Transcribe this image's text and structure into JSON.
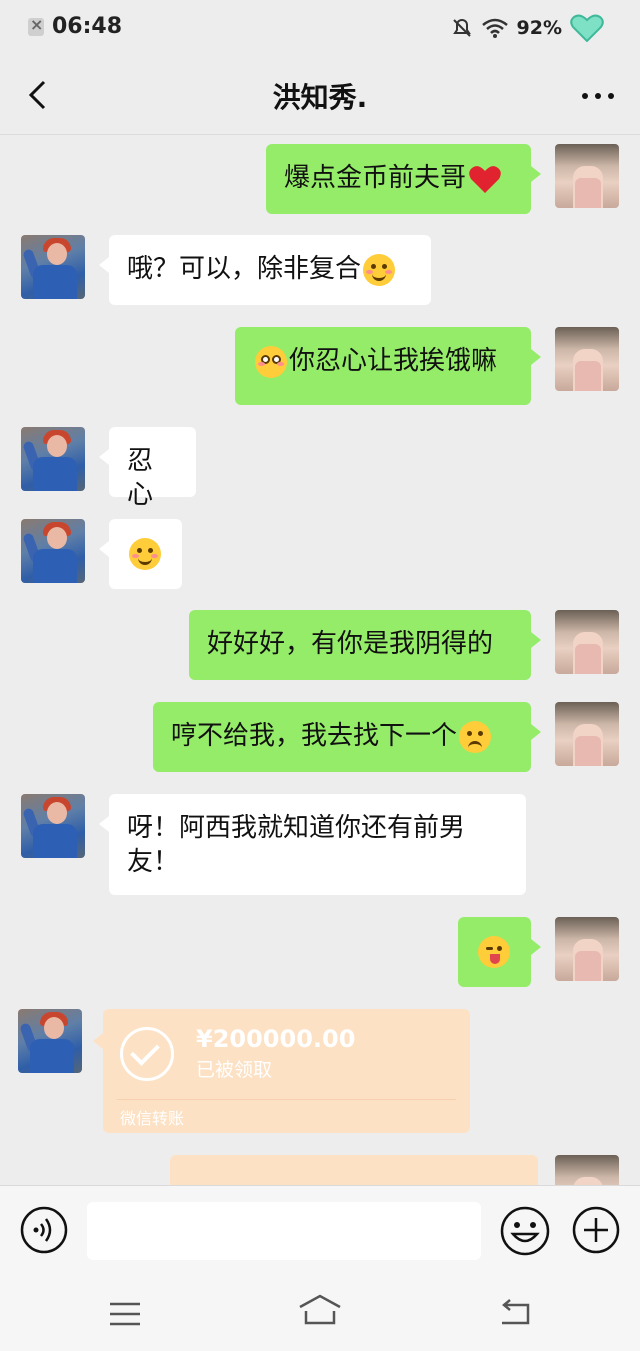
{
  "status_bar": {
    "time": "06:48",
    "battery": "92%"
  },
  "header": {
    "title": "洪知秀."
  },
  "messages": [
    {
      "sender": "me",
      "text": "爆点金币前夫哥",
      "emoji": "red-heart"
    },
    {
      "sender": "other",
      "text": "哦？可以，除非复合",
      "emoji": "smile"
    },
    {
      "sender": "me",
      "emoji_prefix": "pleading",
      "text": "你忍心让我挨饿嘛"
    },
    {
      "sender": "other",
      "text": "忍心"
    },
    {
      "sender": "other",
      "emoji": "smile"
    },
    {
      "sender": "me",
      "text": "好好好，有你是我阴得的"
    },
    {
      "sender": "me",
      "text": "哼不给我，我去找下一个",
      "emoji": "frown"
    },
    {
      "sender": "other",
      "text_line1": "呀！阿西我就知道你还有前男",
      "text_line2": "友！"
    },
    {
      "sender": "me",
      "emoji": "wink-tongue"
    }
  ],
  "transfer": {
    "amount": "¥200000.00",
    "status": "已被领取",
    "footer": "微信转账"
  },
  "input": {
    "placeholder": ""
  },
  "icons": [
    "back-icon",
    "more-icon",
    "voice-icon",
    "emoji-icon",
    "plus-icon",
    "menu-icon",
    "home-icon",
    "return-icon"
  ],
  "colors": {
    "my_bubble": "#95ec69",
    "other_bubble": "#ffffff",
    "transfer": "#fde1c4",
    "background": "#ededed"
  }
}
